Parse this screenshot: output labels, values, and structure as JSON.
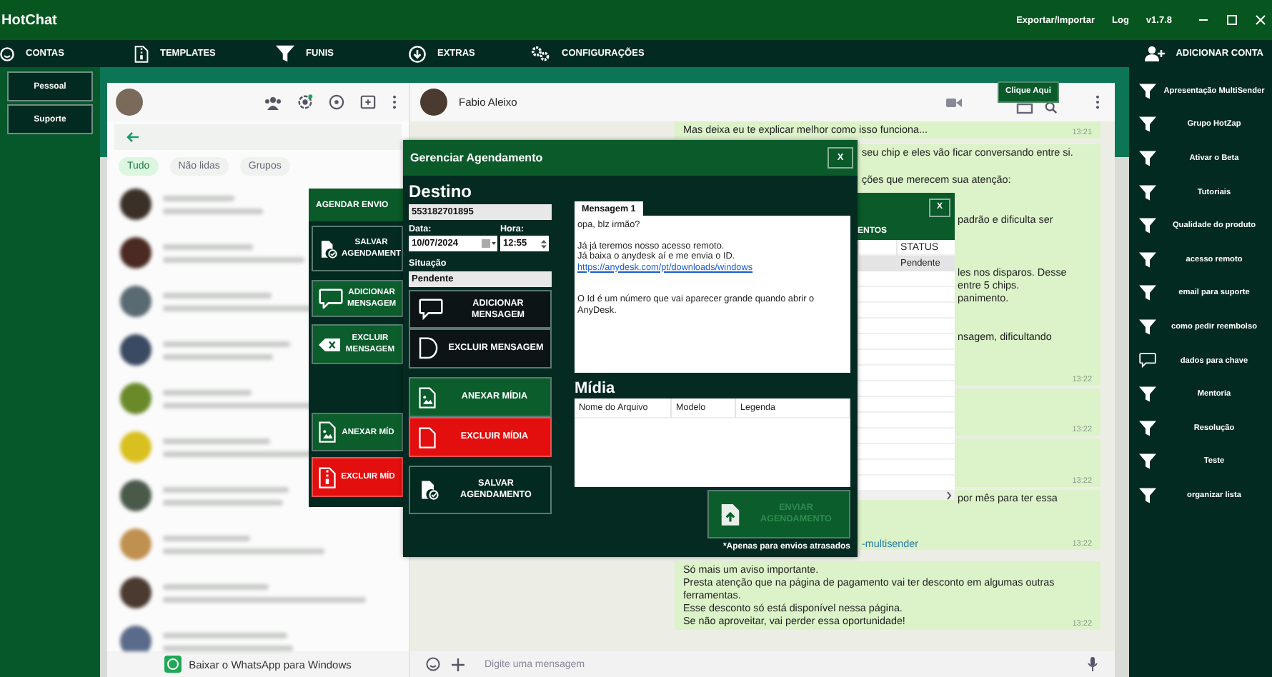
{
  "app": {
    "title": "HotChat",
    "menu": [
      "Exportar/Importar",
      "Log",
      "v1.7.8"
    ]
  },
  "nav": {
    "items": [
      "CONTAS",
      "TEMPLATES",
      "FUNIS",
      "EXTRAS",
      "CONFIGURAÇÕES"
    ],
    "add_account": "ADICIONAR CONTA"
  },
  "accounts": [
    "Pessoal",
    "Suporte"
  ],
  "whatsapp": {
    "filters": [
      {
        "label": "Tudo",
        "selected": true
      },
      {
        "label": "Não lidas",
        "selected": false
      },
      {
        "label": "Grupos",
        "selected": false
      }
    ],
    "download_banner": "Baixar o WhatsApp para Windows",
    "contact": "Fabio Aleixo",
    "message_placeholder": "Digite uma mensagem",
    "messages": [
      {
        "lines": [
          "Mas deixa eu te explicar melhor como isso funciona..."
        ],
        "time": "13:21"
      },
      {
        "lines": [
          "seu chip e eles vão ficar conversando entre si.",
          "ções que merecem sua atenção:",
          "padrão e dificulta ser",
          "les nos disparos. Desse",
          "entre 5 chips.",
          "panimento.",
          "nsagem, dificultando"
        ],
        "time": "13:22"
      },
      {
        "time": "13:22"
      },
      {
        "time": "13:22"
      },
      {
        "lines": [
          "por mês para ter essa"
        ],
        "link": "-multisender",
        "time": "13:22"
      },
      {
        "lines": [
          "Só mais um aviso importante.",
          "Presta atenção que na página de pagamento vai ter desconto em algumas outras ferramentas.",
          "Esse desconto só está disponível nessa página.",
          "Se não aproveitar, vai perder essa oportunidade!"
        ],
        "time": "13:22"
      }
    ]
  },
  "help_button": "Clique Aqui",
  "shortcuts": [
    {
      "label": "Apresentação MultiSender",
      "kind": "funnel"
    },
    {
      "label": "Grupo HotZap",
      "kind": "funnel"
    },
    {
      "label": "Ativar o Beta",
      "kind": "funnel"
    },
    {
      "label": "Tutoriais",
      "kind": "funnel"
    },
    {
      "label": "Qualidade do produto",
      "kind": "funnel"
    },
    {
      "label": "acesso remoto",
      "kind": "funnel"
    },
    {
      "label": "email para suporte",
      "kind": "funnel"
    },
    {
      "label": "como pedir reembolso",
      "kind": "funnel"
    },
    {
      "label": "dados para chave",
      "kind": "message"
    },
    {
      "label": "Mentoria",
      "kind": "funnel"
    },
    {
      "label": "Resolução",
      "kind": "funnel"
    },
    {
      "label": "Teste",
      "kind": "funnel"
    },
    {
      "label": "organizar lista",
      "kind": "funnel"
    }
  ],
  "schedule_panel": {
    "title": "AGENDAR ENVIO",
    "buttons": [
      {
        "label": "SALVAR AGENDAMENT",
        "kind": "neutral"
      },
      {
        "label": "ADICIONAR MENSAGEM",
        "kind": "primary"
      },
      {
        "label": "EXCLUIR MENSAGEM",
        "kind": "primary"
      },
      {
        "label": "ANEXAR MÍD",
        "kind": "primary"
      },
      {
        "label": "EXCLUIR MÍD",
        "kind": "danger"
      }
    ]
  },
  "schedule_list": {
    "title": "ENTOS",
    "close": "X",
    "columns": [
      "STATUS"
    ],
    "rows": [
      {
        "cells": [
          "Pendente"
        ],
        "selected": true
      }
    ]
  },
  "schedule_dialog": {
    "title": "Gerenciar Agendamento",
    "close": "X",
    "heading": "Destino",
    "destination": "553182701895",
    "date_label": "Data:",
    "date": "10/07/2024",
    "time_label": "Hora:",
    "time": "12:55",
    "status_label": "Situação",
    "status": "Pendente",
    "buttons": [
      {
        "label": "ADICIONAR MENSAGEM",
        "kind": "black"
      },
      {
        "label": "EXCLUIR MENSAGEM",
        "kind": "black"
      },
      {
        "label": "ANEXAR MÍDIA",
        "kind": "primary"
      },
      {
        "label": "EXCLUIR MÍDIA",
        "kind": "danger"
      },
      {
        "label": "SALVAR AGENDAMENTO",
        "kind": "neutral"
      }
    ],
    "tab": "Mensagem 1",
    "message": [
      {
        "kind": "text",
        "text": "opa, blz irmão?"
      },
      {
        "kind": "text",
        "text": "Já já teremos nosso acesso remoto."
      },
      {
        "kind": "text",
        "text": "Já baixa o anydesk aí e me envia o ID."
      },
      {
        "kind": "link",
        "text": "https://anydesk.com/pt/downloads/windows"
      },
      {
        "kind": "text",
        "text": "O Id é um número que vai aparecer grande quando abrir o AnyDesk."
      }
    ],
    "media_heading": "Mídia",
    "media_columns": [
      "Nome do Arquivo",
      "Modelo",
      "Legenda"
    ],
    "send_button": {
      "label": "ENVIAR AGENDAMENTO",
      "disabled": true
    },
    "note": "*Apenas para envios atrasados"
  }
}
